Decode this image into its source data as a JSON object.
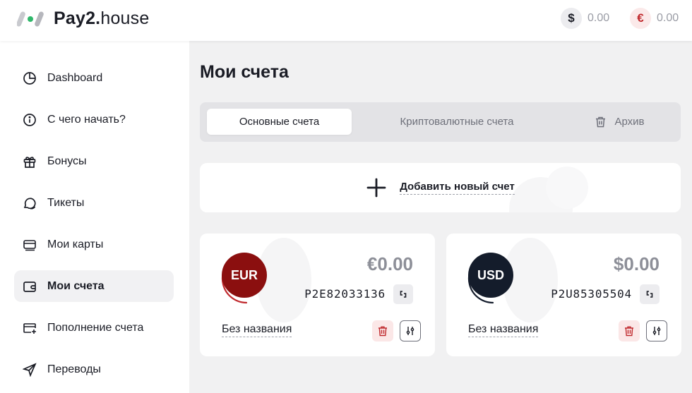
{
  "header": {
    "logo_bold": "Pay2.",
    "logo_regular": "house",
    "balances": [
      {
        "symbol": "$",
        "value": "0.00"
      },
      {
        "symbol": "€",
        "value": "0.00"
      }
    ]
  },
  "sidebar": {
    "items": [
      {
        "label": "Dashboard",
        "icon": "pie-chart-icon"
      },
      {
        "label": "С чего начать?",
        "icon": "info-icon"
      },
      {
        "label": "Бонусы",
        "icon": "gift-icon"
      },
      {
        "label": "Тикеты",
        "icon": "chat-icon"
      },
      {
        "label": "Мои карты",
        "icon": "cards-icon"
      },
      {
        "label": "Мои счета",
        "icon": "wallet-icon",
        "active": true
      },
      {
        "label": "Пополнение счета",
        "icon": "card-plus-icon"
      },
      {
        "label": "Переводы",
        "icon": "send-icon"
      }
    ]
  },
  "main": {
    "title": "Мои счета",
    "tabs": [
      {
        "label": "Основные счета",
        "active": true
      },
      {
        "label": "Криптовалютные счета"
      },
      {
        "label": "Архив"
      }
    ],
    "add_account_label": "Добавить новый счет",
    "accounts": [
      {
        "currency": "EUR",
        "amount": "€0.00",
        "number": "P2E82033136",
        "name": "Без названия",
        "color": "#8b0f0f",
        "ring_color": "#c0292d"
      },
      {
        "currency": "USD",
        "amount": "$0.00",
        "number": "P2U85305504",
        "name": "Без названия",
        "color": "#141c2b",
        "ring_color": "#141c2b"
      }
    ]
  },
  "colors": {
    "accent_green": "#2fb86a",
    "danger": "#c0292d",
    "dark": "#1a1c25"
  }
}
